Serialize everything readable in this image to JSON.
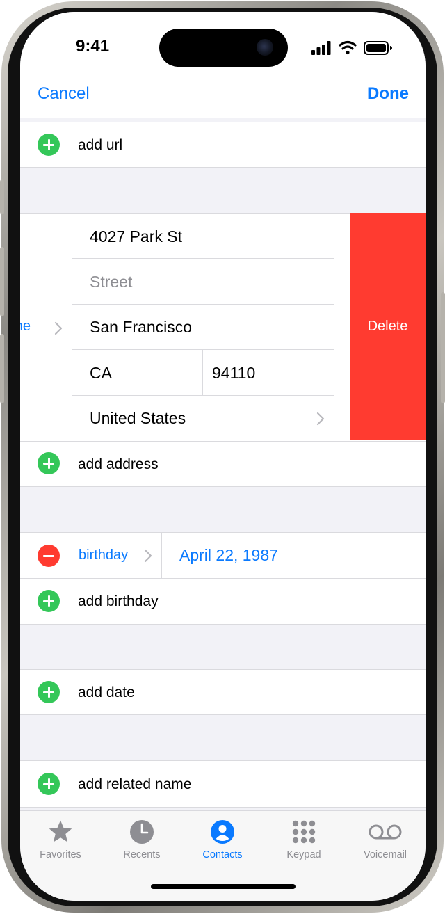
{
  "status_bar": {
    "time": "9:41"
  },
  "nav": {
    "cancel": "Cancel",
    "done": "Done"
  },
  "url_section": {
    "add_label": "add url"
  },
  "address_section": {
    "type_label": "home",
    "street1": "4027 Park St",
    "street2_placeholder": "Street",
    "city": "San Francisco",
    "state": "CA",
    "zip": "94110",
    "country": "United States",
    "delete_label": "Delete",
    "add_label": "add address"
  },
  "birthday_section": {
    "type_label": "birthday",
    "value": "April 22, 1987",
    "add_label": "add birthday"
  },
  "date_section": {
    "add_label": "add date"
  },
  "related_section": {
    "add_label": "add related name"
  },
  "tab_bar": {
    "tabs": [
      {
        "label": "Favorites",
        "icon": "star-icon",
        "active": false
      },
      {
        "label": "Recents",
        "icon": "clock-icon",
        "active": false
      },
      {
        "label": "Contacts",
        "icon": "person-icon",
        "active": true
      },
      {
        "label": "Keypad",
        "icon": "keypad-icon",
        "active": false
      },
      {
        "label": "Voicemail",
        "icon": "voicemail-icon",
        "active": false
      }
    ]
  },
  "colors": {
    "accent": "#0a7aff",
    "add": "#34c759",
    "delete": "#ff3b30",
    "grouped_background": "#f2f2f7",
    "inactive_tab": "#8e8e93"
  }
}
